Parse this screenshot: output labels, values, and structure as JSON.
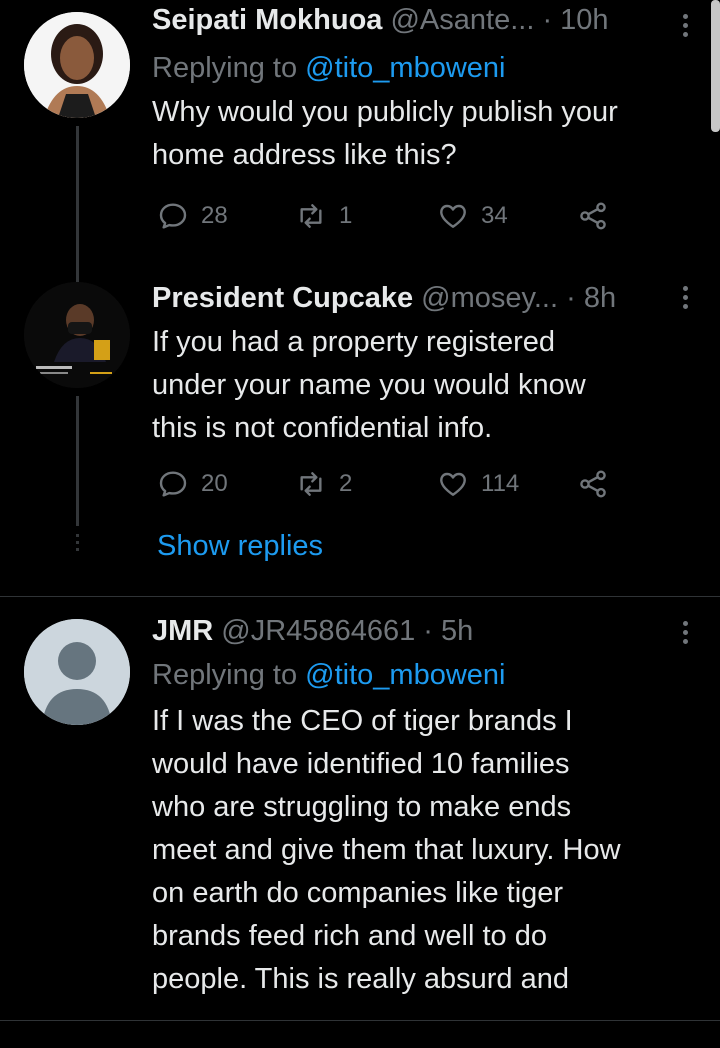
{
  "tweets": [
    {
      "name": "Seipati Mokhuoa",
      "handle": "@Asante...",
      "time": "· 10h",
      "replying_prefix": "Replying to ",
      "replying_handle": "@tito_mboweni",
      "text_lines": [
        "Why would you publicly publish your",
        "home address like this?"
      ],
      "replies": "28",
      "retweets": "1",
      "likes": "34"
    },
    {
      "name": "President Cupcake",
      "handle": "@mosey...",
      "time": "· 8h",
      "text_lines": [
        "If you had a property registered",
        "under your name you would know",
        "this is not confidential info."
      ],
      "replies": "20",
      "retweets": "2",
      "likes": "114",
      "show_replies": "Show replies"
    },
    {
      "name": "JMR",
      "handle": "@JR45864661",
      "time": "· 5h",
      "replying_prefix": "Replying to ",
      "replying_handle": "@tito_mboweni",
      "text_lines": [
        "If I was the CEO of tiger brands I",
        "would have identified 10 families",
        "who are struggling to make ends",
        "meet and give them that luxury. How",
        "on earth do companies like tiger",
        "brands feed rich and well to do",
        "people. This is really absurd and"
      ]
    }
  ],
  "colors": {
    "accent": "#1d9bf0",
    "muted": "#71767b",
    "text": "#e7e9ea",
    "background": "#000000"
  },
  "icons": {
    "reply": "comment-icon",
    "retweet": "retweet-icon",
    "like": "heart-icon",
    "share": "share-icon",
    "more": "more-vertical-icon"
  }
}
